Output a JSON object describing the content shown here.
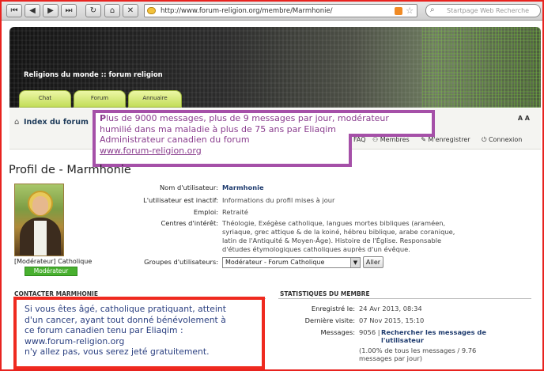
{
  "browser": {
    "url": "http://www.forum-religion.org/membre/Marmhonie/",
    "search_placeholder": "Startpage Web Recherche",
    "back_icon": "arrow-left-icon",
    "forward_icon": "arrow-right-icon",
    "last_icon": "skip-forward-icon",
    "reload_icon": "reload-icon",
    "home_icon": "home-icon",
    "first_icon": "skip-back-icon"
  },
  "site": {
    "title": "Religions du monde :: forum religion",
    "tabs": [
      {
        "label": "Chat"
      },
      {
        "label": "Forum"
      },
      {
        "label": "Annuaire"
      }
    ]
  },
  "nav": {
    "index": "Index du forum",
    "aa": "A A",
    "links": [
      "FAQ",
      "Membres",
      "M'enregistrer",
      "Connexion"
    ]
  },
  "purple_overlay": {
    "first_letter": "P",
    "line1_rest": "lus de 9000 messages, plus de 9 messages par jour, modérateur",
    "line2": "humilié dans ma maladie à plus de 75 ans par Eliaqim",
    "line3": "Administrateur canadien du forum",
    "link": "www.forum-religion.org",
    "border_color": "#a550a8"
  },
  "profile": {
    "title": "Profil de - Marmhonie",
    "avatar_caption": "[Modérateur] Catholique",
    "role_badge": "Modérateur",
    "fields": {
      "username_label": "Nom d'utilisateur:",
      "username": "Marmhonie",
      "inactive_label": "L'utilisateur est inactif:",
      "inactive_value": "Informations du profil mises à jour",
      "job_label": "Emploi:",
      "job": "Retraité",
      "interests_label": "Centres d'intérêt:",
      "interests_1": "Théologie, Exégèse catholique, langues mortes bibliques (araméen,",
      "interests_2": "syriaque, grec attique & de la koiné, hébreu biblique, arabe coranique,",
      "interests_3": "latin de l'Antiquité & Moyen-Âge). Histoire de l'Église. Responsable",
      "interests_4": "d'études étymologiques catholiques auprès d'un évêque.",
      "groups_label": "Groupes d'utilisateurs:",
      "group_selected": "Modérateur - Forum Catholique",
      "go_button": "Aller"
    }
  },
  "contact": {
    "heading": "CONTACTER MARMHONIE"
  },
  "red_overlay": {
    "line1": "Si vous êtes âgé, catholique pratiquant, atteint",
    "line2": "d'un cancer, ayant tout donné bénévolement à",
    "line3": "ce forum canadien tenu par Eliaqim :",
    "line4": "www.forum-religion.org",
    "line5": "n'y allez pas, vous serez jeté gratuitement.",
    "border_color": "#ef2a1f"
  },
  "stats": {
    "heading": "STATISTIQUES DU MEMBRE",
    "registered_label": "Enregistré le:",
    "registered": "24 Avr 2013, 08:34",
    "last_visit_label": "Dernière visite:",
    "last_visit": "07 Nov 2015, 15:10",
    "messages_label": "Messages:",
    "messages_count": "9056",
    "messages_sep": "|",
    "messages_link": "Rechercher les messages de l'utilisateur",
    "messages_note": "(1.00% de tous les messages / 9.76 messages par jour)"
  }
}
